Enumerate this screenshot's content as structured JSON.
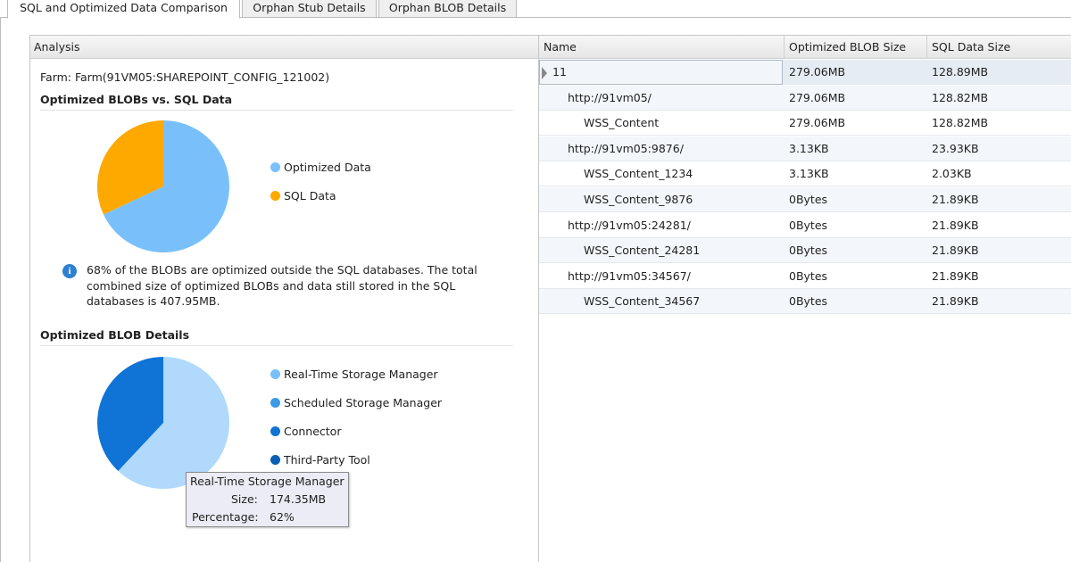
{
  "tabs": [
    {
      "label": "SQL and Optimized Data Comparison",
      "active": true
    },
    {
      "label": "Orphan Stub Details",
      "active": false
    },
    {
      "label": "Orphan BLOB Details",
      "active": false
    }
  ],
  "analysis": {
    "header": "Analysis",
    "farm": "Farm: Farm(91VM05:SHAREPOINT_CONFIG_121002)",
    "section1_title": "Optimized BLOBs vs. SQL Data",
    "section2_title": "Optimized BLOB Details",
    "pie1_legend": [
      {
        "label": "Optimized Data",
        "color": "#79c0fb"
      },
      {
        "label": "SQL Data",
        "color": "#fda900"
      }
    ],
    "info_percent": "68%",
    "info_text_mid": " of the BLOBs are optimized outside the SQL databases. The total combined size of optimized BLOBs and data still stored in the SQL databases is ",
    "info_total": "407.95MB",
    "info_end": ".",
    "pie2_legend": [
      {
        "label": "Real-Time Storage Manager",
        "color": "#79c0fb"
      },
      {
        "label": "Scheduled Storage Manager",
        "color": "#3a9ae6"
      },
      {
        "label": "Connector",
        "color": "#0f74d6"
      },
      {
        "label": "Third-Party Tool",
        "color": "#0a5fb4"
      }
    ],
    "tooltip": {
      "title": "Real-Time Storage Manager",
      "size_label": "Size:",
      "size_value": "174.35MB",
      "percentage_label": "Percentage:",
      "percentage_value": "62%"
    }
  },
  "chart_data": [
    {
      "type": "pie",
      "title": "Optimized BLOBs vs. SQL Data",
      "categories": [
        "Optimized Data",
        "SQL Data"
      ],
      "values": [
        68,
        32
      ],
      "colors": [
        "#79c0fb",
        "#fda900"
      ]
    },
    {
      "type": "pie",
      "title": "Optimized BLOB Details",
      "categories": [
        "Real-Time Storage Manager",
        "Scheduled Storage Manager",
        "Connector",
        "Third-Party Tool"
      ],
      "values": [
        62,
        0,
        38,
        0
      ],
      "colors": [
        "#b0d9fc",
        "#3a9ae6",
        "#0f74d6",
        "#0a5fb4"
      ]
    }
  ],
  "grid": {
    "columns": [
      "Name",
      "Optimized BLOB Size",
      "SQL Data Size"
    ],
    "rows": [
      {
        "name": "11",
        "indent": 0,
        "blob": "279.06MB",
        "sql": "128.89MB",
        "selected": true
      },
      {
        "name": "http://91vm05/",
        "indent": 1,
        "blob": "279.06MB",
        "sql": "128.82MB"
      },
      {
        "name": "WSS_Content",
        "indent": 2,
        "blob": "279.06MB",
        "sql": "128.82MB"
      },
      {
        "name": "http://91vm05:9876/",
        "indent": 1,
        "blob": "3.13KB",
        "sql": "23.93KB"
      },
      {
        "name": "WSS_Content_1234",
        "indent": 2,
        "blob": "3.13KB",
        "sql": "2.03KB"
      },
      {
        "name": "WSS_Content_9876",
        "indent": 2,
        "blob": "0Bytes",
        "sql": "21.89KB"
      },
      {
        "name": "http://91vm05:24281/",
        "indent": 1,
        "blob": "0Bytes",
        "sql": "21.89KB"
      },
      {
        "name": "WSS_Content_24281",
        "indent": 2,
        "blob": "0Bytes",
        "sql": "21.89KB"
      },
      {
        "name": "http://91vm05:34567/",
        "indent": 1,
        "blob": "0Bytes",
        "sql": "21.89KB"
      },
      {
        "name": "WSS_Content_34567",
        "indent": 2,
        "blob": "0Bytes",
        "sql": "21.89KB"
      }
    ]
  }
}
